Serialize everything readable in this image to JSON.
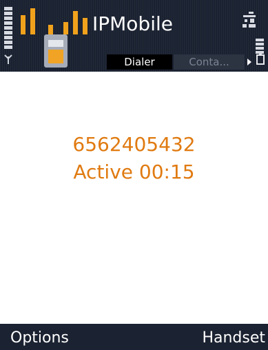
{
  "status_pane": {
    "app_title": "IPMobile",
    "tabs": [
      {
        "label": "Dialer",
        "active": true
      },
      {
        "label": "Conta...",
        "active": false
      }
    ],
    "icons": {
      "signal": "signal-strength-icon",
      "antenna": "antenna-icon",
      "battery": "battery-icon",
      "connectivity": "network-connectivity-icon",
      "tab_scroll": "tab-scroll-arrow-icon"
    }
  },
  "call": {
    "number": "6562405432",
    "status": "Active 00:15"
  },
  "softkeys": {
    "left": "Options",
    "right": "Handset"
  },
  "colors": {
    "header_bg": "#1a2130",
    "accent": "#e07a10",
    "logo_orange": "#f1a21c",
    "softkey_bg": "#1b2231"
  }
}
